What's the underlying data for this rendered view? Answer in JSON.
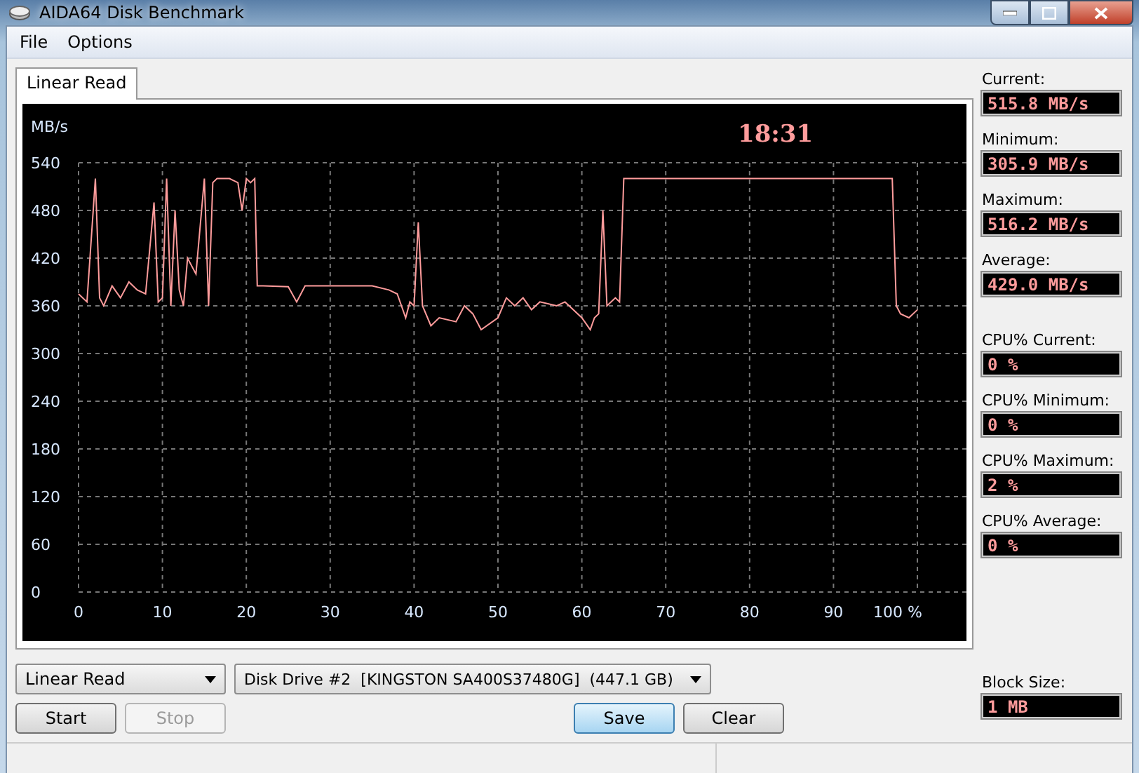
{
  "window": {
    "title": "AIDA64 Disk Benchmark"
  },
  "menu": [
    "File",
    "Options"
  ],
  "tabs": [
    {
      "label": "Linear Read",
      "selected": true
    }
  ],
  "chart": {
    "elapsed_time": "18:31",
    "chart_data": {
      "type": "line",
      "grid": true,
      "ylabel": "MB/s",
      "xlim": [
        0,
        100
      ],
      "ylim": [
        0,
        540
      ],
      "xticks": [
        0,
        10,
        20,
        30,
        40,
        50,
        60,
        70,
        80,
        90,
        {
          "value": 100,
          "label": "100 %"
        }
      ],
      "yticks": [
        0,
        60,
        120,
        180,
        240,
        300,
        360,
        420,
        480,
        540
      ],
      "x": [
        0,
        1,
        2,
        2.5,
        3,
        4,
        5,
        6,
        7,
        8,
        9,
        9.5,
        10,
        10.5,
        11,
        11.5,
        12,
        12.5,
        13,
        14,
        15,
        15.5,
        16,
        16.5,
        17,
        18,
        19,
        19.5,
        20,
        20.5,
        21,
        21.3,
        22,
        25,
        26,
        27,
        30,
        35,
        37,
        38,
        38.5,
        39,
        39.5,
        40,
        40.5,
        41,
        42,
        43,
        45,
        46,
        47,
        48,
        50,
        51,
        52,
        53,
        54,
        55,
        57,
        58,
        60,
        61,
        61.5,
        62,
        62.5,
        63,
        64,
        64.5,
        65,
        70,
        80,
        90,
        97,
        97.5,
        98,
        99,
        100
      ],
      "series": [
        {
          "color": "#ff9c9c",
          "values": [
            375,
            365,
            520,
            370,
            360,
            385,
            370,
            390,
            380,
            375,
            490,
            365,
            370,
            520,
            360,
            480,
            380,
            360,
            420,
            400,
            520,
            360,
            515,
            520,
            520,
            520,
            515,
            480,
            520,
            515,
            520,
            385,
            385,
            384,
            365,
            385,
            385,
            385,
            380,
            375,
            360,
            345,
            365,
            360,
            465,
            360,
            335,
            345,
            340,
            360,
            350,
            330,
            345,
            370,
            360,
            370,
            355,
            365,
            360,
            365,
            345,
            330,
            345,
            350,
            480,
            360,
            370,
            365,
            520,
            520,
            520,
            520,
            520,
            360,
            350,
            345,
            355
          ]
        }
      ]
    }
  },
  "stats": [
    {
      "label": "Current:",
      "value": "515.8 MB/s"
    },
    {
      "label": "Minimum:",
      "value": "305.9 MB/s"
    },
    {
      "label": "Maximum:",
      "value": "516.2 MB/s"
    },
    {
      "label": "Average:",
      "value": "429.0 MB/s"
    }
  ],
  "cpu_stats": [
    {
      "label": "CPU% Current:",
      "value": "0 %"
    },
    {
      "label": "CPU% Minimum:",
      "value": "0 %"
    },
    {
      "label": "CPU% Maximum:",
      "value": "2 %"
    },
    {
      "label": "CPU% Average:",
      "value": "0 %"
    }
  ],
  "block_size": {
    "label": "Block Size:",
    "value": "1 MB"
  },
  "mode_dropdown": {
    "value": "Linear Read"
  },
  "drive_dropdown": {
    "value": "Disk Drive #2  [KINGSTON SA400S37480G]  (447.1 GB)"
  },
  "buttons": [
    {
      "label": "Start",
      "disabled": false,
      "default": false
    },
    {
      "label": "Stop",
      "disabled": true,
      "default": false
    },
    {
      "label": "Save",
      "disabled": false,
      "default": true
    },
    {
      "label": "Clear",
      "disabled": false,
      "default": false
    }
  ]
}
